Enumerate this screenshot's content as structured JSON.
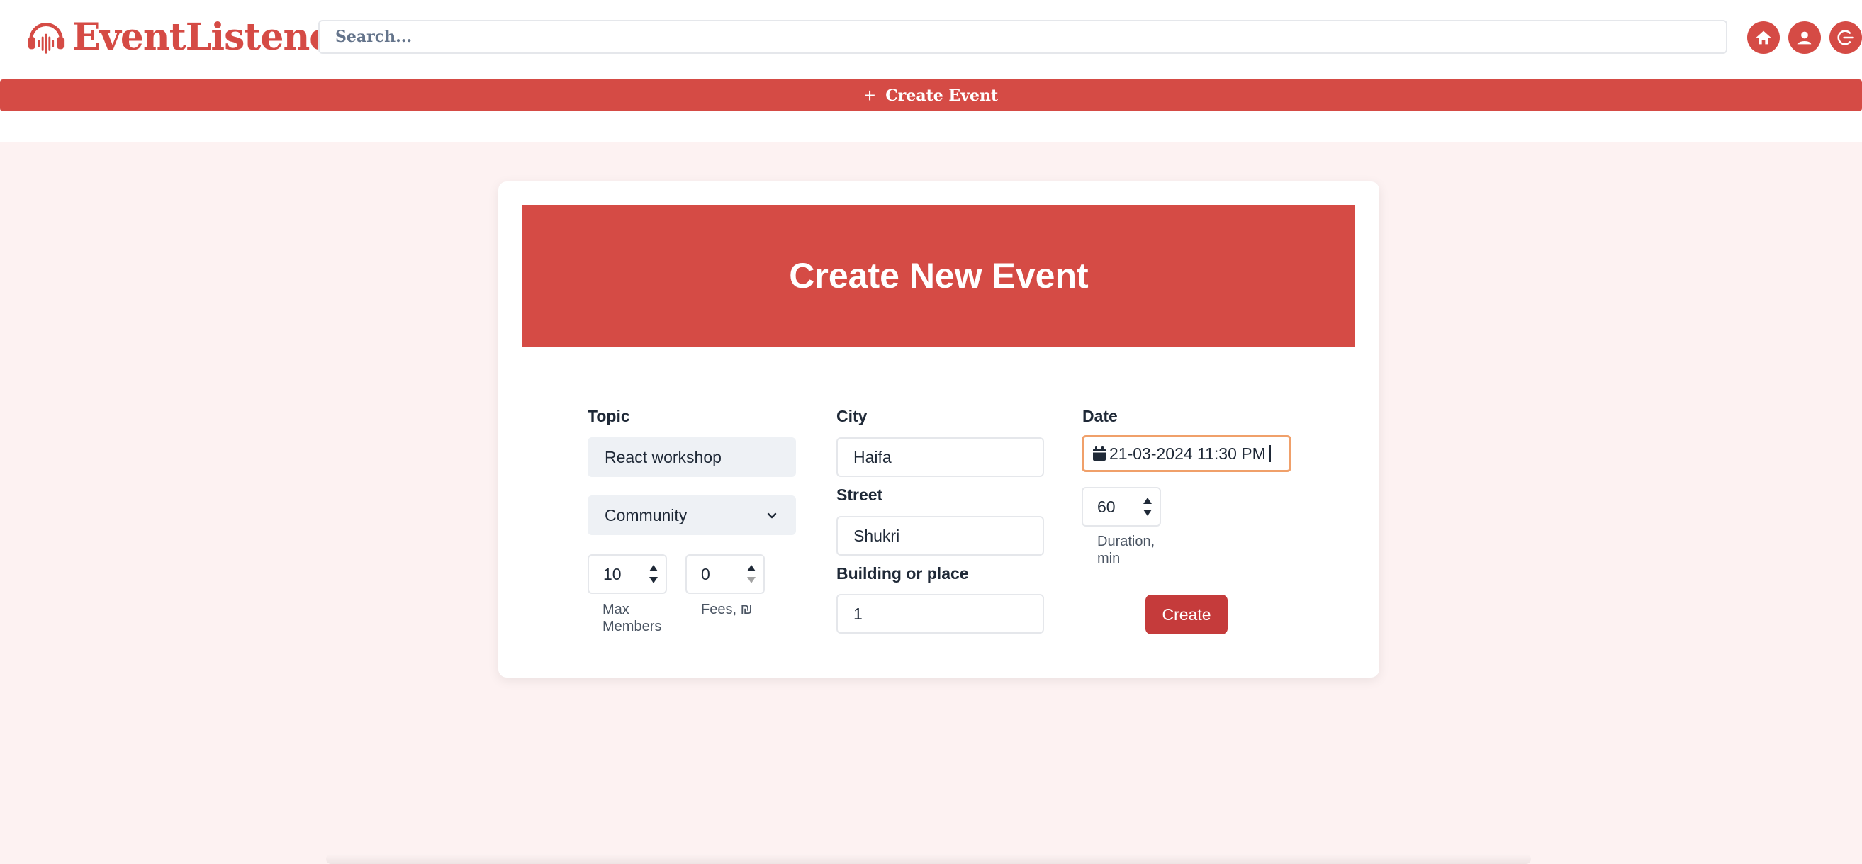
{
  "header": {
    "brand": "EventListener",
    "search_placeholder": "Search...",
    "icons": [
      "home-icon",
      "user-icon",
      "logout-icon"
    ]
  },
  "create_bar": {
    "icon": "plus-icon",
    "label": "Create Event"
  },
  "form": {
    "title": "Create New Event",
    "topic": {
      "label": "Topic",
      "value": "React workshop"
    },
    "category": {
      "selected": "Community"
    },
    "max_members": {
      "value": "10",
      "label": "Max Members"
    },
    "fees": {
      "value": "0",
      "label": "Fees, ₪"
    },
    "city": {
      "label": "City",
      "value": "Haifa"
    },
    "street": {
      "label": "Street",
      "value": "Shukri"
    },
    "building": {
      "label": "Building or place",
      "value": "1"
    },
    "date": {
      "label": "Date",
      "value": "21-03-2024 11:30 PM"
    },
    "duration": {
      "value": "60",
      "label": "Duration, min"
    },
    "submit_label": "Create"
  },
  "colors": {
    "brand": "#d54b45",
    "button": "#c53b3b",
    "page_bg": "#fdf2f2",
    "focus_border": "#f0a06a"
  }
}
